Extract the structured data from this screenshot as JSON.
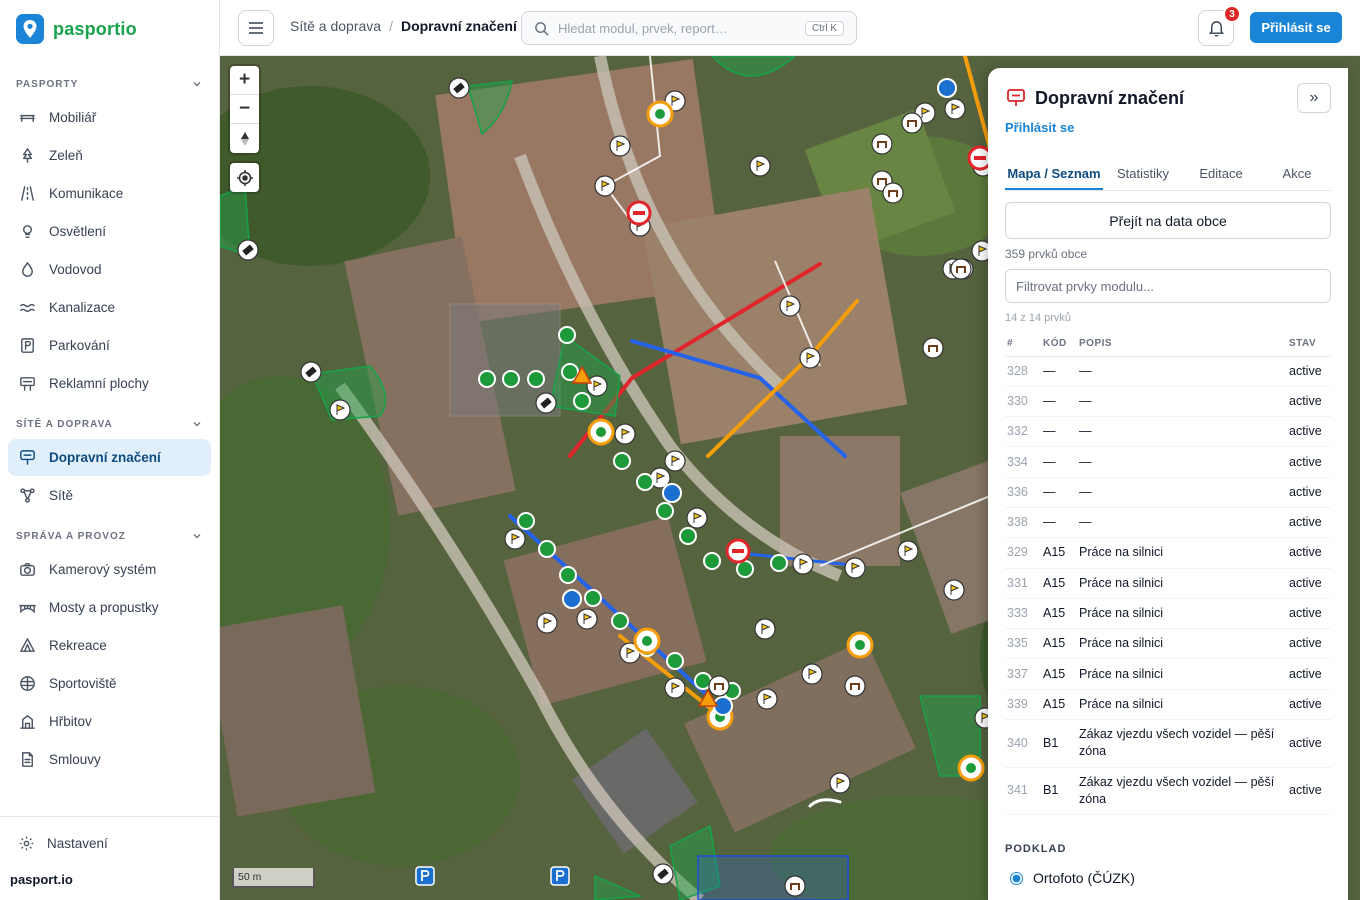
{
  "app": {
    "name": "pasportio",
    "site": "pasport.io"
  },
  "sidebar": {
    "sections": [
      {
        "title": "PASPORTY",
        "items": [
          {
            "label": "Mobiliář",
            "icon": "bench-icon"
          },
          {
            "label": "Zeleň",
            "icon": "tree-icon"
          },
          {
            "label": "Komunikace",
            "icon": "road-icon"
          },
          {
            "label": "Osvětlení",
            "icon": "lightbulb-icon"
          },
          {
            "label": "Vodovod",
            "icon": "water-drop-icon"
          },
          {
            "label": "Kanalizace",
            "icon": "waves-icon"
          },
          {
            "label": "Parkování",
            "icon": "parking-icon"
          },
          {
            "label": "Reklamní plochy",
            "icon": "billboard-icon"
          }
        ]
      },
      {
        "title": "SÍTĚ A DOPRAVA",
        "items": [
          {
            "label": "Dopravní značení",
            "icon": "traffic-sign-icon",
            "active": true
          },
          {
            "label": "Sítě",
            "icon": "network-icon"
          }
        ]
      },
      {
        "title": "SPRÁVA A PROVOZ",
        "items": [
          {
            "label": "Kamerový systém",
            "icon": "camera-icon"
          },
          {
            "label": "Mosty a propustky",
            "icon": "bridge-icon"
          },
          {
            "label": "Rekreace",
            "icon": "tent-icon"
          },
          {
            "label": "Sportoviště",
            "icon": "ball-icon"
          },
          {
            "label": "Hřbitov",
            "icon": "cemetery-icon"
          },
          {
            "label": "Smlouvy",
            "icon": "document-icon"
          }
        ]
      }
    ],
    "settings_label": "Nastavení"
  },
  "header": {
    "breadcrumb_parent": "Sítě a doprava",
    "breadcrumb_separator": "/",
    "breadcrumb_current": "Dopravní značení",
    "search_placeholder": "Hledat modul, prvek, report…",
    "search_shortcut": "Ctrl K",
    "notification_count": "3",
    "login_label": "Přihlásit se"
  },
  "map": {
    "zoom_in": "+",
    "zoom_out": "−",
    "scale_label": "50 m",
    "colors": {
      "red_line": "#e0262a",
      "blue_line": "#2563eb",
      "orange_line": "#f59e0b",
      "green_marker": "#1d9a3a"
    }
  },
  "panel": {
    "title": "Dopravní značení",
    "collapse_label": "»",
    "login_link": "Přihlásit se",
    "tabs": [
      "Mapa / Seznam",
      "Statistiky",
      "Editace",
      "Akce"
    ],
    "active_tab": "Mapa / Seznam",
    "data_button": "Přejít na data obce",
    "count_text": "359 prvků obce",
    "filter_placeholder": "Filtrovat prvky modulu...",
    "subcount_text": "14 z 14 prvků",
    "table": {
      "columns": [
        "#",
        "KÓD",
        "POPIS",
        "STAV"
      ],
      "rows": [
        {
          "id": "328",
          "code": "—",
          "desc": "—",
          "status": "active"
        },
        {
          "id": "330",
          "code": "—",
          "desc": "—",
          "status": "active"
        },
        {
          "id": "332",
          "code": "—",
          "desc": "—",
          "status": "active"
        },
        {
          "id": "334",
          "code": "—",
          "desc": "—",
          "status": "active"
        },
        {
          "id": "336",
          "code": "—",
          "desc": "—",
          "status": "active"
        },
        {
          "id": "338",
          "code": "—",
          "desc": "—",
          "status": "active"
        },
        {
          "id": "329",
          "code": "A15",
          "desc": "Práce na silnici",
          "status": "active"
        },
        {
          "id": "331",
          "code": "A15",
          "desc": "Práce na silnici",
          "status": "active"
        },
        {
          "id": "333",
          "code": "A15",
          "desc": "Práce na silnici",
          "status": "active"
        },
        {
          "id": "335",
          "code": "A15",
          "desc": "Práce na silnici",
          "status": "active"
        },
        {
          "id": "337",
          "code": "A15",
          "desc": "Práce na silnici",
          "status": "active"
        },
        {
          "id": "339",
          "code": "A15",
          "desc": "Práce na silnici",
          "status": "active"
        },
        {
          "id": "340",
          "code": "B1",
          "desc": "Zákaz vjezdu všech vozidel — pěší zóna",
          "status": "active"
        },
        {
          "id": "341",
          "code": "B1",
          "desc": "Zákaz vjezdu všech vozidel — pěší zóna",
          "status": "active"
        }
      ]
    },
    "basemap_heading": "PODKLAD",
    "basemap_option": "Ortofoto (ČÚZK)"
  }
}
